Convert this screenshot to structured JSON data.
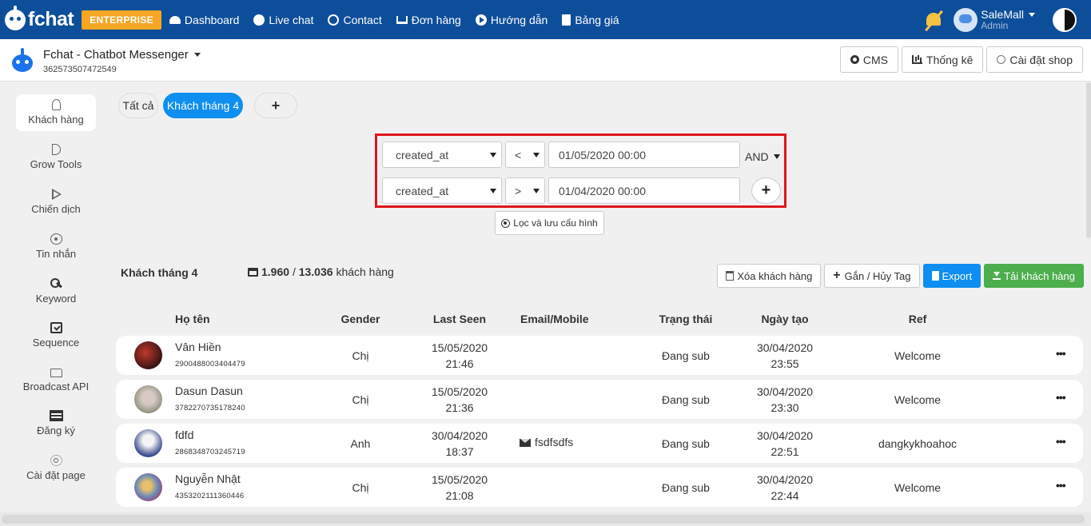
{
  "nav": {
    "brand": "fchat",
    "edition_badge": "ENTERPRISE",
    "links": [
      {
        "label": "Dashboard",
        "icon": "dashboard-icon"
      },
      {
        "label": "Live chat",
        "icon": "chat-icon"
      },
      {
        "label": "Contact",
        "icon": "contact-icon"
      },
      {
        "label": "Đơn hàng",
        "icon": "cart-icon"
      },
      {
        "label": "Hướng dẫn",
        "icon": "play-circle-icon"
      },
      {
        "label": "Bảng giá",
        "icon": "document-icon"
      }
    ],
    "user": {
      "name": "SaleMall",
      "role": "Admin",
      "avatar_label": "fchat"
    }
  },
  "page": {
    "title": "Fchat - Chatbot Messenger",
    "page_id": "362573507472549",
    "buttons": {
      "cms": "CMS",
      "stats": "Thống kê",
      "shop_settings": "Cài đặt shop"
    }
  },
  "sidebar": {
    "items": [
      {
        "label": "Khách hàng",
        "icon": "user-icon",
        "active": true
      },
      {
        "label": "Grow Tools",
        "icon": "grow-tools-icon"
      },
      {
        "label": "Chiến dịch",
        "icon": "play-icon"
      },
      {
        "label": "Tin nhắn",
        "icon": "message-atom-icon"
      },
      {
        "label": "Keyword",
        "icon": "key-icon"
      },
      {
        "label": "Sequence",
        "icon": "calendar-check-icon"
      },
      {
        "label": "Broadcast API",
        "icon": "folder-icon"
      },
      {
        "label": "Đăng ký",
        "icon": "list-icon"
      },
      {
        "label": "Cài đặt page",
        "icon": "settings-icon"
      }
    ]
  },
  "tabs": [
    {
      "label": "Tất cả"
    },
    {
      "label": "Khách tháng 4",
      "active": true
    },
    {
      "label": "+"
    }
  ],
  "filter": {
    "conditions": [
      {
        "field": "created_at",
        "operator": "<",
        "value": "01/05/2020 00:00"
      },
      {
        "field": "created_at",
        "operator": ">",
        "value": "01/04/2020 00:00"
      }
    ],
    "logic": "AND",
    "add_label": "+",
    "save_label": "Lọc và lưu cấu hình"
  },
  "summary": {
    "segment": "Khách tháng 4",
    "filtered": "1.960",
    "separator": "/",
    "total": "13.036",
    "unit": "khách hàng"
  },
  "actions": {
    "delete": "Xóa khách hàng",
    "tag": "Gắn / Hủy Tag",
    "export": "Export",
    "download": "Tải khách hàng"
  },
  "table": {
    "headers": {
      "name": "Họ tên",
      "gender": "Gender",
      "last_seen": "Last Seen",
      "email": "Email/Mobile",
      "status": "Trạng thái",
      "created": "Ngày tạo",
      "ref": "Ref"
    },
    "rows": [
      {
        "name": "Vân Hiền",
        "id": "2900488003404479",
        "gender": "Chị",
        "last_seen_date": "15/05/2020",
        "last_seen_time": "21:46",
        "email": "",
        "status": "Đang sub",
        "created_date": "30/04/2020",
        "created_time": "23:55",
        "ref": "Welcome",
        "more": "•••"
      },
      {
        "name": "Dasun Dasun",
        "id": "3782270735178240",
        "gender": "Chị",
        "last_seen_date": "15/05/2020",
        "last_seen_time": "21:36",
        "email": "",
        "status": "Đang sub",
        "created_date": "30/04/2020",
        "created_time": "23:30",
        "ref": "Welcome",
        "more": "•••"
      },
      {
        "name": "fdfd",
        "id": "2868348703245719",
        "gender": "Anh",
        "last_seen_date": "30/04/2020",
        "last_seen_time": "18:37",
        "email": "fsdfsdfs",
        "status": "Đang sub",
        "created_date": "30/04/2020",
        "created_time": "22:51",
        "ref": "dangkykhoahoc",
        "more": "•••"
      },
      {
        "name": "Nguyễn Nhật",
        "id": "4353202111360446",
        "gender": "Chị",
        "last_seen_date": "15/05/2020",
        "last_seen_time": "21:08",
        "email": "",
        "status": "Đang sub",
        "created_date": "30/04/2020",
        "created_time": "22:44",
        "ref": "Welcome",
        "more": "•••"
      }
    ]
  }
}
